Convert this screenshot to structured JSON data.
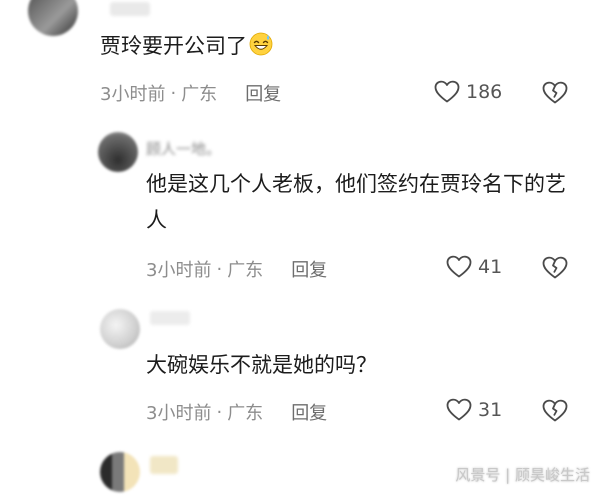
{
  "comments": [
    {
      "username": "",
      "text": "贾玲要开公司了",
      "emoji": "grinning-sweat-emoji",
      "time": "3小时前",
      "separator": "·",
      "location": "广东",
      "reply_label": "回复",
      "likes": "186"
    },
    {
      "username": "顾人一地。",
      "text": "他是这几个人老板，他们签约在贾玲名下的艺人",
      "time": "3小时前",
      "separator": "·",
      "location": "广东",
      "reply_label": "回复",
      "likes": "41"
    },
    {
      "username": "",
      "text": "大碗娱乐不就是她的吗？",
      "time": "3小时前",
      "separator": "·",
      "location": "广东",
      "reply_label": "回复",
      "likes": "31"
    }
  ],
  "watermark": "风景号 | 顾昊峻生活",
  "colors": {
    "text": "#1c1c1c",
    "meta": "#8d8d8d",
    "icon": "#4a4a4a"
  }
}
